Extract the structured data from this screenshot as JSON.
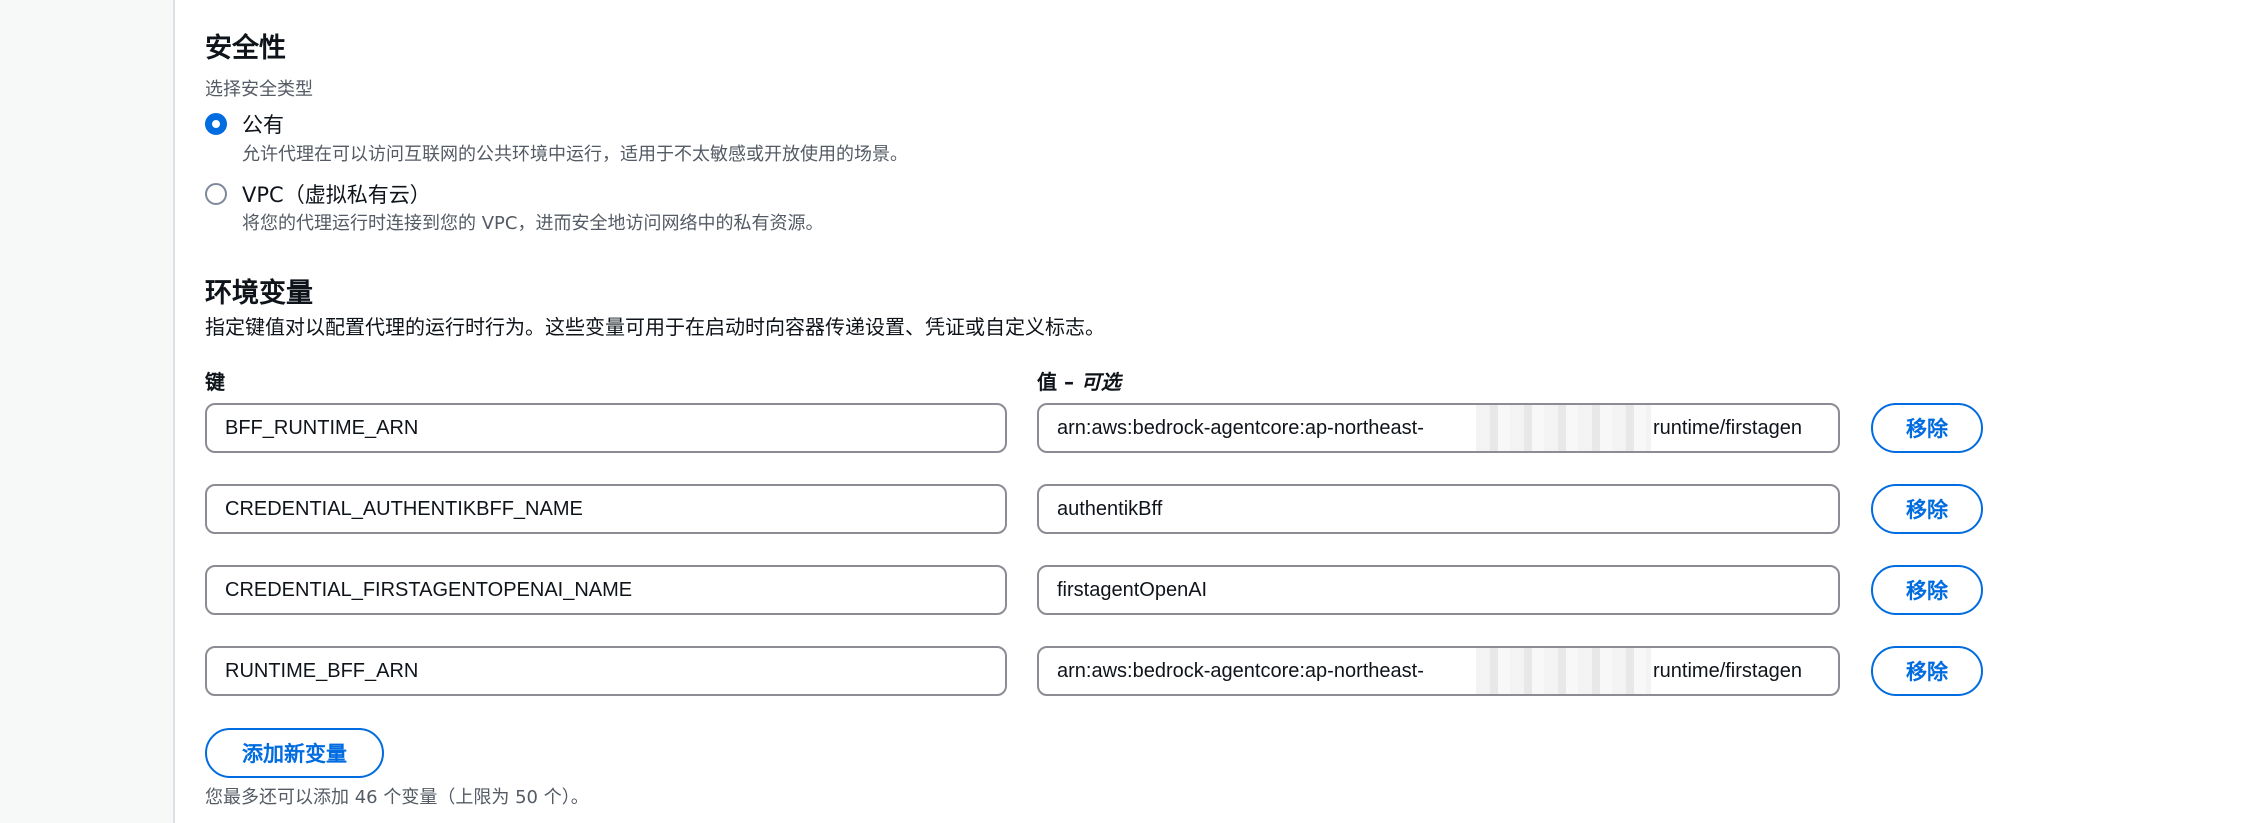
{
  "security": {
    "title": "安全性",
    "type_label": "选择安全类型",
    "options": [
      {
        "label": "公有",
        "description": "允许代理在可以访问互联网的公共环境中运行，适用于不太敏感或开放使用的场景。",
        "selected": true
      },
      {
        "label": "VPC（虚拟私有云）",
        "description": "将您的代理运行时连接到您的 VPC，进而安全地访问网络中的私有资源。",
        "selected": false
      }
    ]
  },
  "env": {
    "title": "环境变量",
    "description": "指定键值对以配置代理的运行时行为。这些变量可用于在启动时向容器传递设置、凭证或自定义标志。",
    "key_label": "键",
    "value_label": "值",
    "value_optional": "可选",
    "remove_label": "移除",
    "add_label": "添加新变量",
    "limit_text": "您最多还可以添加 46 个变量（上限为 50 个）。",
    "rows": [
      {
        "key": "BFF_RUNTIME_ARN",
        "value_prefix": "arn:aws:bedrock-agentcore:ap-northeast-",
        "value_suffix": "runtime/firstagen"
      },
      {
        "key": "CREDENTIAL_AUTHENTIKBFF_NAME",
        "value_prefix": "authentikBff",
        "value_suffix": ""
      },
      {
        "key": "CREDENTIAL_FIRSTAGENTOPENAI_NAME",
        "value_prefix": "firstagentOpenAI",
        "value_suffix": ""
      },
      {
        "key": "RUNTIME_BFF_ARN",
        "value_prefix": "arn:aws:bedrock-agentcore:ap-northeast-",
        "value_suffix": "runtime/firstagen"
      }
    ]
  },
  "colors": {
    "accent": "#006ce0",
    "text": "#0f141a",
    "muted": "#545b64",
    "border": "#8c8c94"
  }
}
